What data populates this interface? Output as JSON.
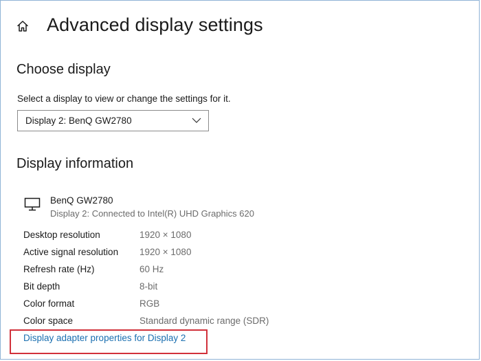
{
  "header": {
    "home_icon": "home-icon",
    "title": "Advanced display settings"
  },
  "choose_display": {
    "title": "Choose display",
    "instruction": "Select a display to view or change the settings for it.",
    "selected_display": "Display 2: BenQ GW2780",
    "dropdown_icon": "chevron-down-icon"
  },
  "display_information": {
    "title": "Display information",
    "monitor_icon": "monitor-icon",
    "monitor_name": "BenQ GW2780",
    "connection": "Display 2: Connected to Intel(R) UHD Graphics 620",
    "rows": [
      {
        "label": "Desktop resolution",
        "value": "1920 × 1080"
      },
      {
        "label": "Active signal resolution",
        "value": "1920 × 1080"
      },
      {
        "label": "Refresh rate (Hz)",
        "value": "60 Hz"
      },
      {
        "label": "Bit depth",
        "value": "8-bit"
      },
      {
        "label": "Color format",
        "value": "RGB"
      },
      {
        "label": "Color space",
        "value": "Standard dynamic range (SDR)"
      }
    ],
    "adapter_link": "Display adapter properties for Display 2"
  },
  "colors": {
    "link": "#1a6fb0",
    "highlight": "#d1303a",
    "secondary_text": "#6b6b6b"
  }
}
